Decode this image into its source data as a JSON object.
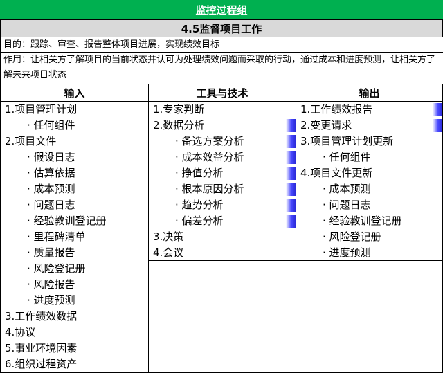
{
  "banner": "监控过程组",
  "subtitle": "4.5监督项目工作",
  "purpose": "目的：跟踪、审查、报告整体项目进展，实现绩效目标",
  "usage": "作用：让相关方了解项目的当前状态并认可为处理绩效问题而采取的行动，通过成本和进度预测，让相关方了解未来项目状态",
  "columns": [
    {
      "header": "输入",
      "items": [
        {
          "text": "1.项目管理计划",
          "level": 1
        },
        {
          "text": "· 任何组件",
          "level": 2
        },
        {
          "text": "2.项目文件",
          "level": 1
        },
        {
          "text": "· 假设日志",
          "level": 2
        },
        {
          "text": "· 估算依据",
          "level": 2
        },
        {
          "text": "· 成本预测",
          "level": 2
        },
        {
          "text": "· 问题日志",
          "level": 2
        },
        {
          "text": "· 经验教训登记册",
          "level": 2
        },
        {
          "text": "· 里程碑清单",
          "level": 2
        },
        {
          "text": "· 质量报告",
          "level": 2
        },
        {
          "text": "· 风险登记册",
          "level": 2
        },
        {
          "text": "· 风险报告",
          "level": 2
        },
        {
          "text": "· 进度预测",
          "level": 2
        },
        {
          "text": "3.工作绩效数据",
          "level": 1
        },
        {
          "text": "4.协议",
          "level": 1
        },
        {
          "text": "5.事业环境因素",
          "level": 1
        },
        {
          "text": "6.组织过程资产",
          "level": 1
        }
      ]
    },
    {
      "header": "工具与技术",
      "items": [
        {
          "text": "1.专家判断",
          "level": 1,
          "mark": false
        },
        {
          "text": "2.数据分析",
          "level": 1,
          "mark": true
        },
        {
          "text": "· 备选方案分析",
          "level": 2,
          "mark": true
        },
        {
          "text": "· 成本效益分析",
          "level": 2,
          "mark": true
        },
        {
          "text": "· 挣值分析",
          "level": 2,
          "mark": true
        },
        {
          "text": "· 根本原因分析",
          "level": 2,
          "mark": true
        },
        {
          "text": "· 趋势分析",
          "level": 2,
          "mark": true
        },
        {
          "text": "· 偏差分析",
          "level": 2,
          "mark": true
        },
        {
          "text": "3.决策",
          "level": 1,
          "mark": false
        },
        {
          "text": "4.会议",
          "level": 1,
          "mark": false
        }
      ]
    },
    {
      "header": "输出",
      "items": [
        {
          "text": "1.工作绩效报告",
          "level": 1,
          "mark": true
        },
        {
          "text": "2.变更请求",
          "level": 1,
          "mark": true
        },
        {
          "text": "3.项目管理计划更新",
          "level": 1,
          "mark": false
        },
        {
          "text": "· 任何组件",
          "level": 2,
          "mark": false
        },
        {
          "text": "4.项目文件更新",
          "level": 1,
          "mark": false
        },
        {
          "text": "· 成本预测",
          "level": 2,
          "mark": false
        },
        {
          "text": "· 问题日志",
          "level": 2,
          "mark": false
        },
        {
          "text": "· 经验教训登记册",
          "level": 2,
          "mark": false
        },
        {
          "text": "· 风险登记册",
          "level": 2,
          "mark": false
        },
        {
          "text": "· 进度预测",
          "level": 2,
          "mark": false
        }
      ]
    }
  ],
  "colors": {
    "banner_bg": "#00b050",
    "subtitle_bg": "#d9d9d9",
    "mark": "#2a2ad8"
  }
}
